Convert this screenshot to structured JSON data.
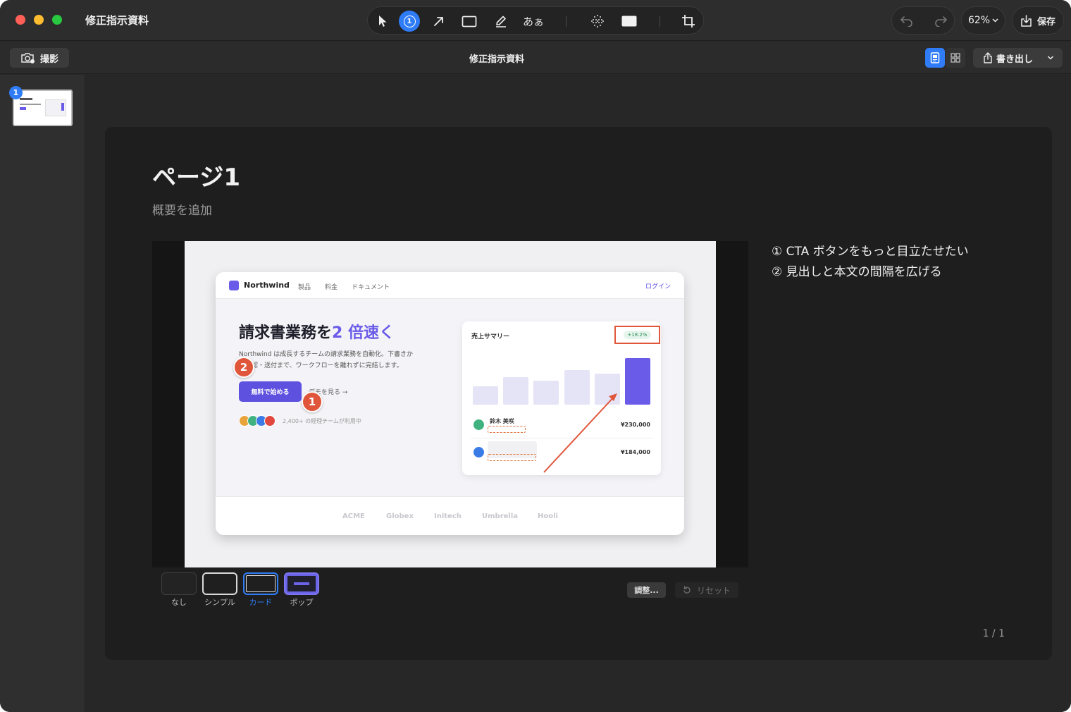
{
  "window": {
    "title": "修正指示資料"
  },
  "toolbar": {
    "marker_tool_number": "1",
    "text_tool_label": "あぁ",
    "zoom_label": "62%",
    "save_label": "保存"
  },
  "subbar": {
    "capture_label": "撮影",
    "document_title": "修正指示資料",
    "export_label": "書き出し"
  },
  "sidebar": {
    "thumbnails": [
      {
        "badge": "1"
      }
    ]
  },
  "page": {
    "title": "ページ1",
    "subtitle": "概要を追加",
    "notes": [
      "① CTA ボタンをもっと目立たせたい",
      "② 見出しと本文の間隔を広げる"
    ],
    "counter": "1 / 1"
  },
  "screenshot": {
    "brand": "Northwind",
    "nav_links": [
      "製品",
      "料金",
      "ドキュメント"
    ],
    "login": "ログイン",
    "hero_main": "請求書業務を",
    "hero_accent": "2 倍速く",
    "description_line1": "Northwind は成長するチームの請求業務を自動化。下書きか",
    "description_line2": "ら承認・送付まで、ワークフローを離れずに完結します。",
    "cta_label": "無料で始める",
    "secondary_link": "デモを見る →",
    "users_text": "2,400+ の経理チームが利用中",
    "avatar_colors": [
      "#e8a33a",
      "#3fb27f",
      "#3b7be6",
      "#e0473e"
    ],
    "panel": {
      "title": "売上サマリー",
      "delta": "+18.2%",
      "bars": [
        0.3,
        0.46,
        0.4,
        0.58,
        0.52,
        0.78
      ],
      "rows": [
        {
          "name": "鈴木 美咲",
          "value": "¥230,000",
          "dot": "#3fb27f"
        },
        {
          "name": "",
          "value": "¥184,000",
          "dot": "#3b7be6"
        }
      ]
    },
    "companies": [
      "ACME",
      "Globex",
      "Initech",
      "Umbrella",
      "Hooli"
    ],
    "markers": [
      "2",
      "1"
    ]
  },
  "style_picker": {
    "options": [
      "なし",
      "シンプル",
      "カード",
      "ポップ"
    ],
    "selected": "カード",
    "adjust_label": "調整...",
    "reset_label": "リセット"
  },
  "colors": {
    "accent": "#2f7cf6",
    "brand": "#6a5be8",
    "annotation": "#e0563b"
  }
}
